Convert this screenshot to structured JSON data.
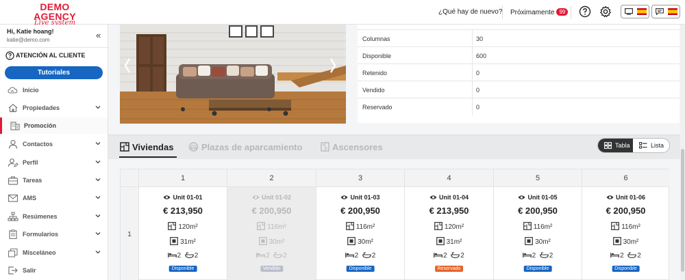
{
  "header": {
    "logo_line1": "DEMO AGENCY",
    "logo_line2": "Live system",
    "whats_new": "¿Qué hay de nuevo?",
    "upcoming": "Próximamente",
    "upcoming_count": "99",
    "help_icon": "question-circle-icon",
    "settings_icon": "gear-icon"
  },
  "sidebar": {
    "greeting": "Hi, Katie hoang!",
    "email": "katie@demo.com",
    "customer_service": "ATENCIÓN AL CLIENTE",
    "tutorials": "Tutoriales",
    "items": [
      {
        "label": "Inicio",
        "icon": "cloud-icon",
        "chevron": false
      },
      {
        "label": "Propiedades",
        "icon": "home-icon",
        "chevron": true
      },
      {
        "label": "Promoción",
        "icon": "building-icon",
        "chevron": false,
        "active": true
      },
      {
        "label": "Contactos",
        "icon": "user-icon",
        "chevron": true
      },
      {
        "label": "Perfil",
        "icon": "user-edit-icon",
        "chevron": true
      },
      {
        "label": "Tareas",
        "icon": "briefcase-icon",
        "chevron": true
      },
      {
        "label": "AMS",
        "icon": "mail-icon",
        "chevron": true
      },
      {
        "label": "Resúmenes",
        "icon": "sitemap-icon",
        "chevron": true
      },
      {
        "label": "Formularios",
        "icon": "clipboard-icon",
        "chevron": true
      },
      {
        "label": "Misceláneo",
        "icon": "layers-icon",
        "chevron": true
      },
      {
        "label": "Salir",
        "icon": "logout-icon",
        "chevron": false
      }
    ]
  },
  "details": [
    {
      "key": "Columnas",
      "value": "30"
    },
    {
      "key": "Disponible",
      "value": "600"
    },
    {
      "key": "Retenido",
      "value": "0"
    },
    {
      "key": "Vendido",
      "value": "0"
    },
    {
      "key": "Reservado",
      "value": "0"
    }
  ],
  "tabs": [
    {
      "label": "Viviendas",
      "icon": "floorplan-icon",
      "active": true
    },
    {
      "label": "Plazas de aparcamiento",
      "icon": "parking-icon",
      "active": false
    },
    {
      "label": "Ascensores",
      "icon": "elevator-icon",
      "active": false
    }
  ],
  "view_toggle": {
    "table": "Tabla",
    "list": "Lista"
  },
  "grid": {
    "row_label": "1",
    "columns": [
      "1",
      "2",
      "3",
      "4",
      "5",
      "6"
    ],
    "units": [
      {
        "name": "Unit 01-01",
        "price": "€ 213,950",
        "area": "120m²",
        "terrace": "31m²",
        "beds": "2",
        "baths": "2",
        "status": "Disponible",
        "status_color": "#1766c2",
        "sold": false
      },
      {
        "name": "Unit 01-02",
        "price": "€ 200,950",
        "area": "116m²",
        "terrace": "30m²",
        "beds": "2",
        "baths": "2",
        "status": "Vendido",
        "status_color": "#b9bfc8",
        "sold": true
      },
      {
        "name": "Unit 01-03",
        "price": "€ 200,950",
        "area": "116m²",
        "terrace": "30m²",
        "beds": "2",
        "baths": "2",
        "status": "Disponible",
        "status_color": "#1766c2",
        "sold": false
      },
      {
        "name": "Unit 01-04",
        "price": "€ 213,950",
        "area": "120m²",
        "terrace": "31m²",
        "beds": "2",
        "baths": "2",
        "status": "Reservado",
        "status_color": "#e5632a",
        "sold": false
      },
      {
        "name": "Unit 01-05",
        "price": "€ 200,950",
        "area": "116m²",
        "terrace": "30m²",
        "beds": "2",
        "baths": "2",
        "status": "Disponible",
        "status_color": "#1766c2",
        "sold": false
      },
      {
        "name": "Unit 01-06",
        "price": "€ 200,950",
        "area": "116m²",
        "terrace": "30m²",
        "beds": "2",
        "baths": "2",
        "status": "Disponible",
        "status_color": "#1766c2",
        "sold": false
      }
    ]
  }
}
